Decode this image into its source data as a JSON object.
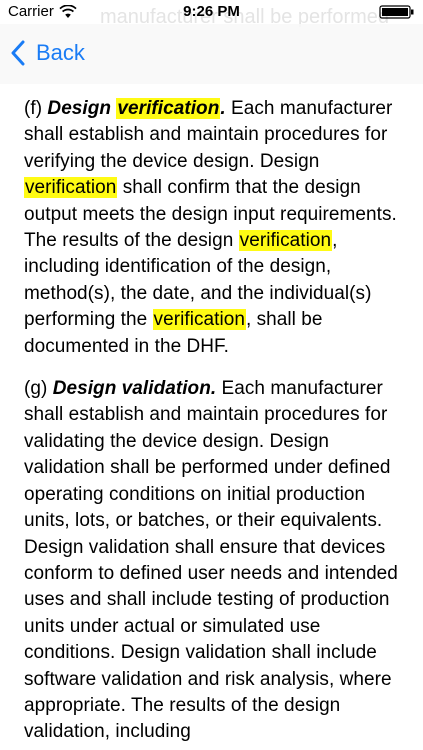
{
  "status_bar": {
    "carrier": "Carrier",
    "time": "9:26 PM"
  },
  "nav": {
    "back_label": "Back",
    "background_text": "manufacturer shall be performed"
  },
  "sections": {
    "f": {
      "prefix": "(f) ",
      "heading_pre": "Design ",
      "heading_hl": "verification",
      "heading_post": ".",
      "t1": " Each manufacturer shall establish and maintain procedures for verifying the device design. Design ",
      "h1": "verification",
      "t2": " shall confirm that the design output meets the design input requirements. The results of the design ",
      "h2": "verification",
      "t3": ", including identification of the design, method(s), the date, and the individual(s) performing the ",
      "h3": "verification",
      "t4": ", shall be documented in the DHF."
    },
    "g": {
      "prefix": "(g) ",
      "heading": "Design validation.",
      "body": " Each manufacturer shall establish and maintain procedures for validating the device design. Design validation shall be performed under defined operating conditions on initial production units, lots, or batches, or their equivalents. Design validation shall ensure that devices conform to defined user needs and intended uses and shall include testing of production units under actual or simulated use conditions. Design validation shall include software validation and risk analysis, where appropriate. The results of the design validation, including"
    }
  },
  "colors": {
    "highlight": "#fffb14",
    "accent": "#1a7cf5"
  },
  "icons": {
    "wifi": "wifi-icon",
    "battery": "battery-icon",
    "back": "chevron-left-icon"
  }
}
